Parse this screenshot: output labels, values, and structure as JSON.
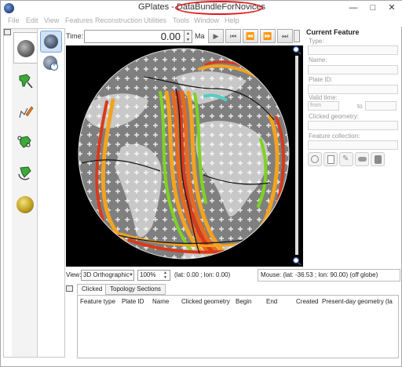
{
  "window": {
    "title_prefix": "GPlates - ",
    "title_project": "DataBundleForNovices",
    "minimize": "—",
    "maximize": "□",
    "close": "✕"
  },
  "menu": [
    "File",
    "Edit",
    "View",
    "Features",
    "Reconstruction",
    "Utilities",
    "Tools",
    "Window",
    "Help"
  ],
  "toolbar": {
    "time_label": "Time:",
    "time_value": "0.00",
    "time_unit": "Ma",
    "buttons": [
      "play-button",
      "rewind-button",
      "step-back-button",
      "step-forward-button",
      "go-to-end-button"
    ]
  },
  "canvas_tools": {
    "tabs": [
      "view-tool-tab",
      "feature-inspection-tab",
      "digitisation-tab",
      "topology-tab",
      "pole-manipulation-tab",
      "small-circle-tab"
    ],
    "buttons": [
      "drag-globe-icon",
      "zoom-globe-icon"
    ]
  },
  "view": {
    "label": "View:",
    "projection": "3D Orthographic",
    "zoom": "100%",
    "camera": "(lat: 0.00 ; lon: 0.00)",
    "mouse": "Mouse: (lat: -36.53 ; lon: 90.00) (off globe)"
  },
  "current_feature": {
    "heading": "Current Feature",
    "type_label": "Type:",
    "name_label": "Name:",
    "plate_id_label": "Plate ID:",
    "valid_time_label": "Valid time:",
    "from_placeholder": "from",
    "to_label": "to",
    "clicked_geometry_label": "Clicked geometry:",
    "feature_collection_label": "Feature collection:"
  },
  "feature_actions": [
    "query-feature-icon",
    "edit-feature-icon",
    "move-vertex-icon",
    "clone-feature-icon",
    "delete-feature-icon"
  ],
  "bottom": {
    "tabs": [
      "Clicked",
      "Topology Sections"
    ],
    "columns": [
      "Feature type",
      "Plate ID",
      "Name",
      "Clicked geometry",
      "Begin",
      "End",
      "Created",
      "Present-day geometry (la"
    ]
  },
  "colors": {
    "title_highlight": "#e0181c",
    "globe_ocean": "#7f7f7f",
    "continent": "#c8c8c8",
    "isochron_young": "#d93a1a",
    "isochron_mid": "#f3a31f",
    "isochron_old": "#7ed321"
  }
}
